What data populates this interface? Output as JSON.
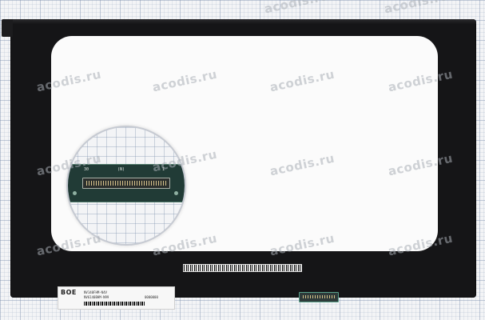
{
  "image": {
    "subject": "laptop LCD matrix panel on grid paper",
    "background_color": "#f3f4f6",
    "panel_color": "#151517",
    "screen_color": "#fbfbfb"
  },
  "watermark": "acodis.ru",
  "magnifier": {
    "pin_label_left": "30",
    "pin_label_mid": "(N)",
    "pin_label_right": "1"
  },
  "sticker": {
    "ce_mark": "BOE",
    "line1": "NV140FHM-N4V",
    "line2": "NV6140BHM-N99",
    "line3": "0000000"
  }
}
